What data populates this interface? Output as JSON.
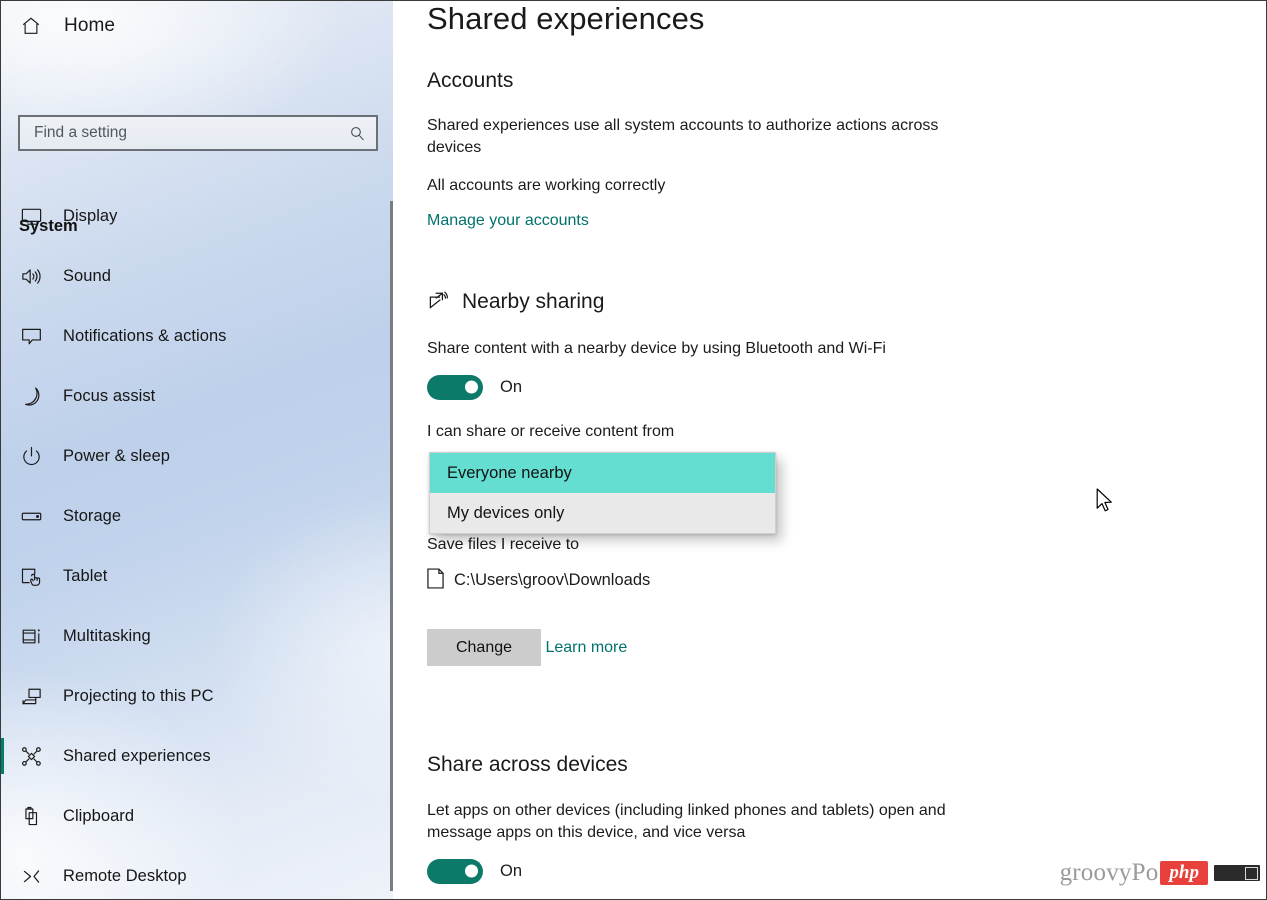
{
  "window": {
    "title": "Settings"
  },
  "sidebar": {
    "home_label": "Home",
    "home_icon": "home-icon",
    "search": {
      "placeholder": "Find a setting",
      "value": "",
      "icon": "search-icon"
    },
    "group_title": "System",
    "accent_color": "#00806c",
    "items": [
      {
        "label": "Display",
        "icon": "monitor-icon",
        "selected": false
      },
      {
        "label": "Sound",
        "icon": "speaker-icon",
        "selected": false
      },
      {
        "label": "Notifications & actions",
        "icon": "chat-bubble-icon",
        "selected": false
      },
      {
        "label": "Focus assist",
        "icon": "moon-icon",
        "selected": false
      },
      {
        "label": "Power & sleep",
        "icon": "power-icon",
        "selected": false
      },
      {
        "label": "Storage",
        "icon": "drive-icon",
        "selected": false
      },
      {
        "label": "Tablet",
        "icon": "tablet-touch-icon",
        "selected": false
      },
      {
        "label": "Multitasking",
        "icon": "multitasking-icon",
        "selected": false
      },
      {
        "label": "Projecting to this PC",
        "icon": "projecting-icon",
        "selected": false
      },
      {
        "label": "Shared experiences",
        "icon": "share-nodes-icon",
        "selected": true
      },
      {
        "label": "Clipboard",
        "icon": "clipboard-icon",
        "selected": false
      },
      {
        "label": "Remote Desktop",
        "icon": "remote-desktop-icon",
        "selected": false
      }
    ]
  },
  "main": {
    "page_title": "Shared experiences",
    "accounts": {
      "heading": "Accounts",
      "description": "Shared experiences use all system accounts to authorize actions across devices",
      "status": "All accounts are working correctly",
      "link": "Manage your accounts"
    },
    "nearby_sharing": {
      "heading": "Nearby sharing",
      "icon": "share-arrow-icon",
      "description": "Share content with a nearby device by using Bluetooth and Wi-Fi",
      "toggle_state": "On",
      "toggle_on": true,
      "toggle_color": "#0d7a69",
      "share_from_label": "I can share or receive content from",
      "share_from_selected": "Everyone nearby",
      "save_to_label": "Save files I receive to",
      "save_path": "C:\\Users\\groov\\Downloads",
      "save_path_icon": "file-icon",
      "change_button": "Change",
      "learn_more": "Learn more"
    },
    "dropdown": {
      "open": true,
      "highlight_color": "#63ded0",
      "options": [
        {
          "label": "Everyone nearby",
          "highlighted": true
        },
        {
          "label": "My devices only",
          "highlighted": false
        }
      ]
    },
    "share_across_devices": {
      "heading": "Share across devices",
      "description": "Let apps on other devices (including linked phones and tablets) open and message apps on this device, and vice versa",
      "toggle_state": "On",
      "toggle_on": true
    }
  },
  "watermark": {
    "text": "groovyPo",
    "badge": "php"
  }
}
